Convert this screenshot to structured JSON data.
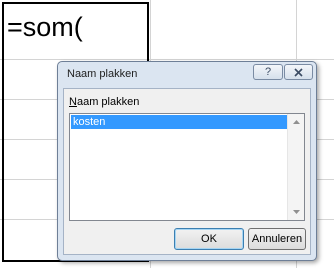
{
  "cell": {
    "formula": "=som("
  },
  "dialog": {
    "title": "Naam plakken",
    "help_icon": "help-icon",
    "close_icon": "close-icon",
    "list_label_mnemonic": "N",
    "list_label_rest": "aam plakken",
    "names": [
      "kosten"
    ],
    "selected_name": "kosten",
    "ok_label": "OK",
    "cancel_label": "Annuleren"
  },
  "colors": {
    "selection": "#3399ff",
    "dialog_frame": "#dbe5f1",
    "dialog_body": "#f0f0f0"
  }
}
